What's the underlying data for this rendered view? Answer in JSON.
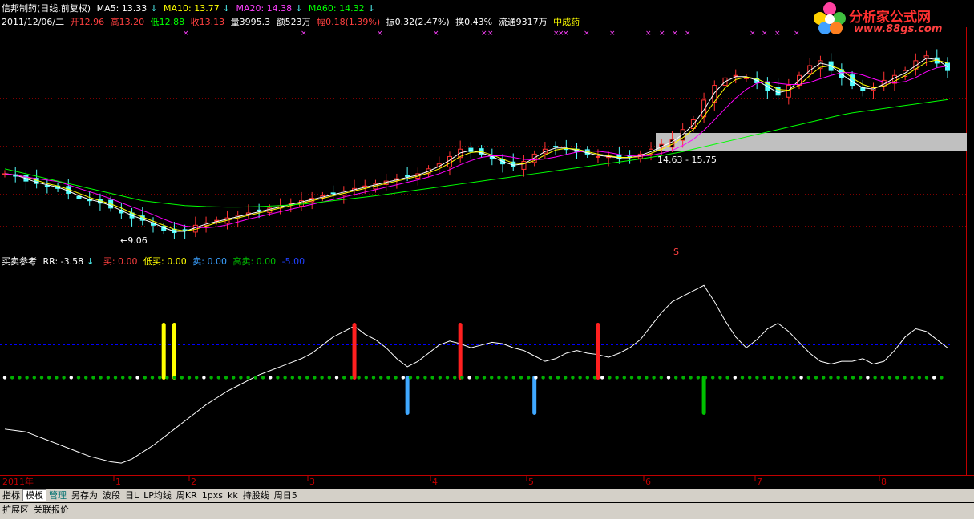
{
  "header": {
    "stock_name": "信邦制药(日线,前复权)",
    "ma5": "MA5: 13.33",
    "ma10": "MA10: 13.77",
    "ma20": "MA20: 14.38",
    "ma60": "MA60: 14.32",
    "date": "2011/12/06/二",
    "open": "开12.96",
    "high": "高13.20",
    "low": "低12.88",
    "close": "收13.13",
    "volume": "量3995.3",
    "amount": "额523万",
    "change": "幅0.18(1.39%)",
    "amplitude": "振0.32(2.47%)",
    "turnover": "换0.43%",
    "float": "流通9317万",
    "sector": "中成药"
  },
  "logo": {
    "name": "分析家公式网",
    "url": "www.88gs.com"
  },
  "annotations": {
    "low_price": "←9.06",
    "range": "14.63 - 15.75",
    "signal": "S"
  },
  "indicator_header": {
    "name": "买卖参考",
    "rr": "RR: -3.58",
    "buy": "买: 0.00",
    "low_buy": "低买: 0.00",
    "sell": "卖: 0.00",
    "high_sell": "高卖: 0.00",
    "ref": "-5.00"
  },
  "axis": {
    "year": "2011年",
    "months": [
      "1",
      "2",
      "3",
      "4",
      "5",
      "6",
      "7",
      "8"
    ]
  },
  "toolbar": {
    "items": [
      "指标",
      "模板",
      "管理",
      "另存为",
      "波段",
      "日L",
      "LP均线",
      "周KR",
      "1pxs",
      "kk",
      "持股线",
      "周日5"
    ]
  },
  "bottom_tabs": {
    "items": [
      "扩展区",
      "关联报价"
    ]
  },
  "colors": {
    "up": "#ff3333",
    "down": "#54ffff",
    "ma5": "#ffffff",
    "ma10": "#ffff00",
    "ma20": "#ff00ff",
    "ma60": "#00ff00",
    "grid": "#800000",
    "panel": "#c00000"
  },
  "chart_data": {
    "type": "candlestick",
    "price_series": [
      {
        "name": "收盘",
        "values": [
          11.6,
          11.5,
          11.3,
          11.2,
          11.1,
          11.0,
          10.8,
          10.6,
          10.5,
          10.4,
          10.2,
          10.0,
          9.8,
          9.7,
          9.5,
          9.3,
          9.2,
          9.3,
          9.5,
          9.6,
          9.7,
          9.8,
          9.9,
          10.0,
          10.1,
          10.2,
          10.3,
          10.4,
          10.5,
          10.6,
          10.7,
          10.8,
          10.9,
          11.0,
          11.1,
          11.2,
          11.3,
          11.4,
          11.5,
          11.6,
          11.8,
          12.0,
          12.3,
          12.6,
          12.5,
          12.4,
          12.2,
          12.0,
          11.9,
          12.1,
          12.4,
          12.6,
          12.7,
          12.6,
          12.5,
          12.4,
          12.3,
          12.3,
          12.2,
          12.3,
          12.4,
          12.6,
          12.8,
          13.0,
          13.4,
          13.8,
          14.6,
          15.2,
          15.5,
          15.6,
          15.5,
          15.3,
          15.0,
          14.8,
          15.2,
          15.6,
          16.0,
          16.2,
          15.8,
          15.5,
          15.2,
          15.0,
          15.1,
          15.4,
          15.6,
          15.8,
          16.2,
          16.4,
          16.1,
          15.8
        ]
      },
      {
        "name": "MA60",
        "values": [
          11.8,
          11.7,
          11.6,
          11.5,
          11.4,
          11.3,
          11.2,
          11.1,
          11.0,
          10.9,
          10.8,
          10.7,
          10.6,
          10.5,
          10.45,
          10.4,
          10.35,
          10.3,
          10.28,
          10.26,
          10.25,
          10.24,
          10.24,
          10.25,
          10.26,
          10.28,
          10.3,
          10.33,
          10.36,
          10.4,
          10.45,
          10.5,
          10.55,
          10.6,
          10.65,
          10.7,
          10.76,
          10.82,
          10.88,
          10.94,
          11.0,
          11.06,
          11.12,
          11.18,
          11.24,
          11.3,
          11.36,
          11.42,
          11.48,
          11.54,
          11.6,
          11.66,
          11.72,
          11.78,
          11.84,
          11.9,
          11.96,
          12.02,
          12.08,
          12.14,
          12.2,
          12.27,
          12.34,
          12.42,
          12.5,
          12.6,
          12.7,
          12.8,
          12.9,
          13.0,
          13.1,
          13.2,
          13.3,
          13.4,
          13.5,
          13.6,
          13.7,
          13.8,
          13.9,
          14.0,
          14.08,
          14.14,
          14.2,
          14.26,
          14.32,
          14.38,
          14.44,
          14.5,
          14.56,
          14.62
        ]
      }
    ],
    "indicator_series": [
      {
        "name": "RR",
        "values": [
          -3.8,
          -3.9,
          -4.0,
          -4.3,
          -4.6,
          -4.9,
          -5.2,
          -5.5,
          -5.8,
          -6.0,
          -6.2,
          -6.3,
          -6.0,
          -5.5,
          -5.0,
          -4.4,
          -3.8,
          -3.2,
          -2.6,
          -2.0,
          -1.5,
          -1.0,
          -0.6,
          -0.2,
          0.2,
          0.5,
          0.8,
          1.1,
          1.4,
          1.8,
          2.4,
          3.0,
          3.4,
          3.8,
          3.2,
          2.8,
          2.2,
          1.4,
          0.8,
          1.2,
          1.8,
          2.4,
          2.7,
          2.5,
          2.2,
          2.4,
          2.6,
          2.5,
          2.2,
          2.0,
          1.6,
          1.2,
          1.4,
          1.8,
          2.0,
          1.8,
          1.7,
          1.5,
          1.8,
          2.2,
          2.8,
          3.8,
          4.8,
          5.6,
          6.0,
          6.4,
          6.8,
          5.6,
          4.2,
          3.0,
          2.2,
          2.8,
          3.6,
          4.0,
          3.4,
          2.6,
          1.8,
          1.2,
          1.0,
          1.2,
          1.2,
          1.4,
          1.0,
          1.2,
          2.0,
          3.0,
          3.6,
          3.4,
          2.8,
          2.2
        ]
      }
    ],
    "signals": [
      {
        "type": "buy",
        "x_index": 15,
        "color": "yellow"
      },
      {
        "type": "buy",
        "x_index": 16,
        "color": "yellow"
      },
      {
        "type": "sell",
        "x_index": 33,
        "color": "red"
      },
      {
        "type": "buy",
        "x_index": 38,
        "color": "blue"
      },
      {
        "type": "sell",
        "x_index": 43,
        "color": "red"
      },
      {
        "type": "buy",
        "x_index": 50,
        "color": "blue"
      },
      {
        "type": "sell",
        "x_index": 56,
        "color": "red"
      },
      {
        "type": "buy",
        "x_index": 66,
        "color": "green"
      }
    ],
    "ylim_price": [
      8.5,
      17.5
    ],
    "ylim_indicator": [
      -7,
      8
    ],
    "grid": true
  }
}
